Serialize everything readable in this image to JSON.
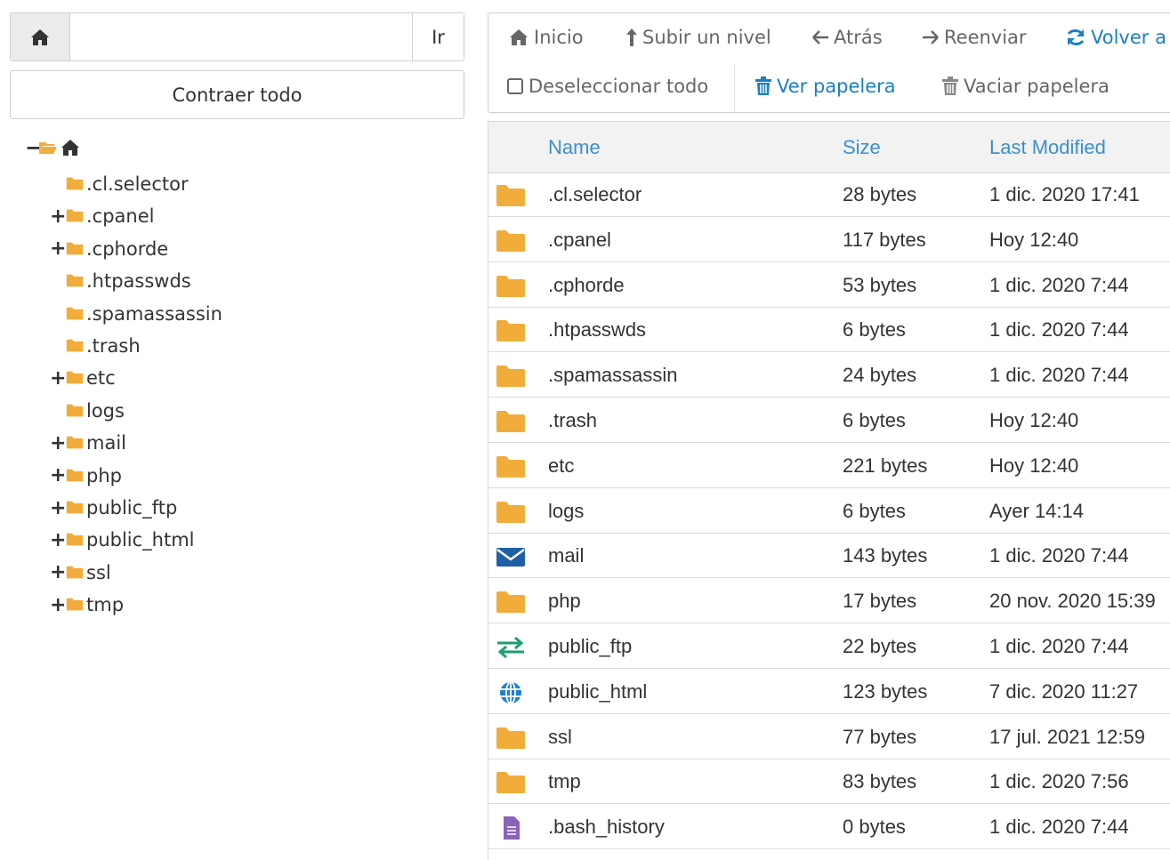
{
  "colors": {
    "folder": "#f0ad3b",
    "link": "#3a8fd1",
    "accent_blue": "#1a7fc4",
    "mail": "#1f5fa8",
    "ftp": "#1f9d6b",
    "web": "#1f7ed8",
    "file": "#8a63b8"
  },
  "left": {
    "path_value": "",
    "go_label": "Ir",
    "collapse_label": "Contraer todo",
    "tree": [
      {
        "name": ".cl.selector",
        "expandable": false
      },
      {
        "name": ".cpanel",
        "expandable": true
      },
      {
        "name": ".cphorde",
        "expandable": true
      },
      {
        "name": ".htpasswds",
        "expandable": false
      },
      {
        "name": ".spamassassin",
        "expandable": false
      },
      {
        "name": ".trash",
        "expandable": false
      },
      {
        "name": "etc",
        "expandable": true
      },
      {
        "name": "logs",
        "expandable": false
      },
      {
        "name": "mail",
        "expandable": true
      },
      {
        "name": "php",
        "expandable": true
      },
      {
        "name": "public_ftp",
        "expandable": true
      },
      {
        "name": "public_html",
        "expandable": true
      },
      {
        "name": "ssl",
        "expandable": true
      },
      {
        "name": "tmp",
        "expandable": true
      }
    ]
  },
  "toolbar": {
    "home": "Inicio",
    "up": "Subir un nivel",
    "back": "Atrás",
    "forward": "Reenviar",
    "reload": "Volver a",
    "deselect": "Deseleccionar todo",
    "view_trash": "Ver papelera",
    "empty_trash": "Vaciar papelera"
  },
  "table": {
    "headers": {
      "name": "Name",
      "size": "Size",
      "modified": "Last Modified"
    },
    "rows": [
      {
        "icon": "folder-icon",
        "name": ".cl.selector",
        "size": "28 bytes",
        "modified": "1 dic. 2020 17:41"
      },
      {
        "icon": "folder-icon",
        "name": ".cpanel",
        "size": "117 bytes",
        "modified": "Hoy 12:40"
      },
      {
        "icon": "folder-icon",
        "name": ".cphorde",
        "size": "53 bytes",
        "modified": "1 dic. 2020 7:44"
      },
      {
        "icon": "folder-icon",
        "name": ".htpasswds",
        "size": "6 bytes",
        "modified": "1 dic. 2020 7:44"
      },
      {
        "icon": "folder-icon",
        "name": ".spamassassin",
        "size": "24 bytes",
        "modified": "1 dic. 2020 7:44"
      },
      {
        "icon": "folder-icon",
        "name": ".trash",
        "size": "6 bytes",
        "modified": "Hoy 12:40"
      },
      {
        "icon": "folder-icon",
        "name": "etc",
        "size": "221 bytes",
        "modified": "Hoy 12:40"
      },
      {
        "icon": "folder-icon",
        "name": "logs",
        "size": "6 bytes",
        "modified": "Ayer 14:14"
      },
      {
        "icon": "mail-icon",
        "name": "mail",
        "size": "143 bytes",
        "modified": "1 dic. 2020 7:44"
      },
      {
        "icon": "folder-icon",
        "name": "php",
        "size": "17 bytes",
        "modified": "20 nov. 2020 15:39"
      },
      {
        "icon": "transfer-icon",
        "name": "public_ftp",
        "size": "22 bytes",
        "modified": "1 dic. 2020 7:44"
      },
      {
        "icon": "globe-icon",
        "name": "public_html",
        "size": "123 bytes",
        "modified": "7 dic. 2020 11:27"
      },
      {
        "icon": "folder-icon",
        "name": "ssl",
        "size": "77 bytes",
        "modified": "17 jul. 2021 12:59"
      },
      {
        "icon": "folder-icon",
        "name": "tmp",
        "size": "83 bytes",
        "modified": "1 dic. 2020 7:56"
      },
      {
        "icon": "file-icon",
        "name": ".bash_history",
        "size": "0 bytes",
        "modified": "1 dic. 2020 7:44"
      }
    ]
  }
}
